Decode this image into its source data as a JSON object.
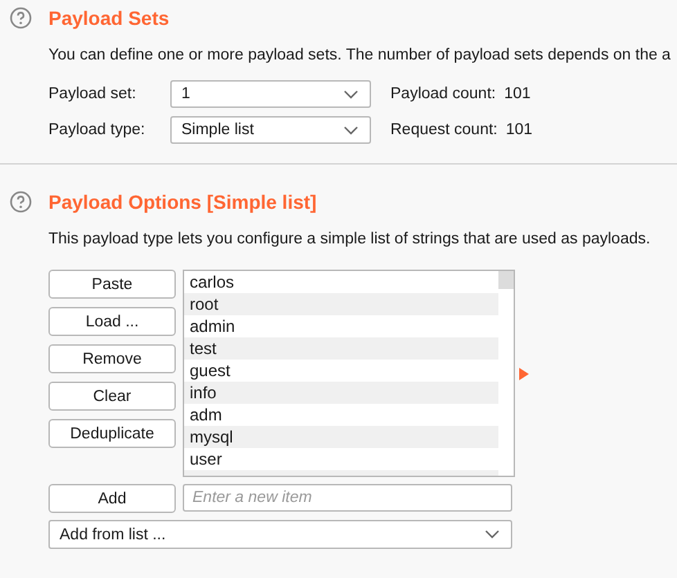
{
  "payload_sets": {
    "title": "Payload Sets",
    "description": "You can define one or more payload sets. The number of payload sets depends on the a",
    "fields": [
      {
        "label": "Payload set:",
        "value": "1",
        "info_label": "Payload count:",
        "info_value": "101"
      },
      {
        "label": "Payload type:",
        "value": "Simple list",
        "info_label": "Request count:",
        "info_value": "101"
      }
    ]
  },
  "payload_options": {
    "title": "Payload Options [Simple list]",
    "description": "This payload type lets you configure a simple list of strings that are used as payloads.",
    "buttons": [
      "Paste",
      "Load ...",
      "Remove",
      "Clear",
      "Deduplicate"
    ],
    "items": [
      "carlos",
      "root",
      "admin",
      "test",
      "guest",
      "info",
      "adm",
      "mysql",
      "user"
    ],
    "add_button": "Add",
    "new_item": {
      "placeholder": "Enter a new item"
    },
    "add_from_list": "Add from list ..."
  }
}
